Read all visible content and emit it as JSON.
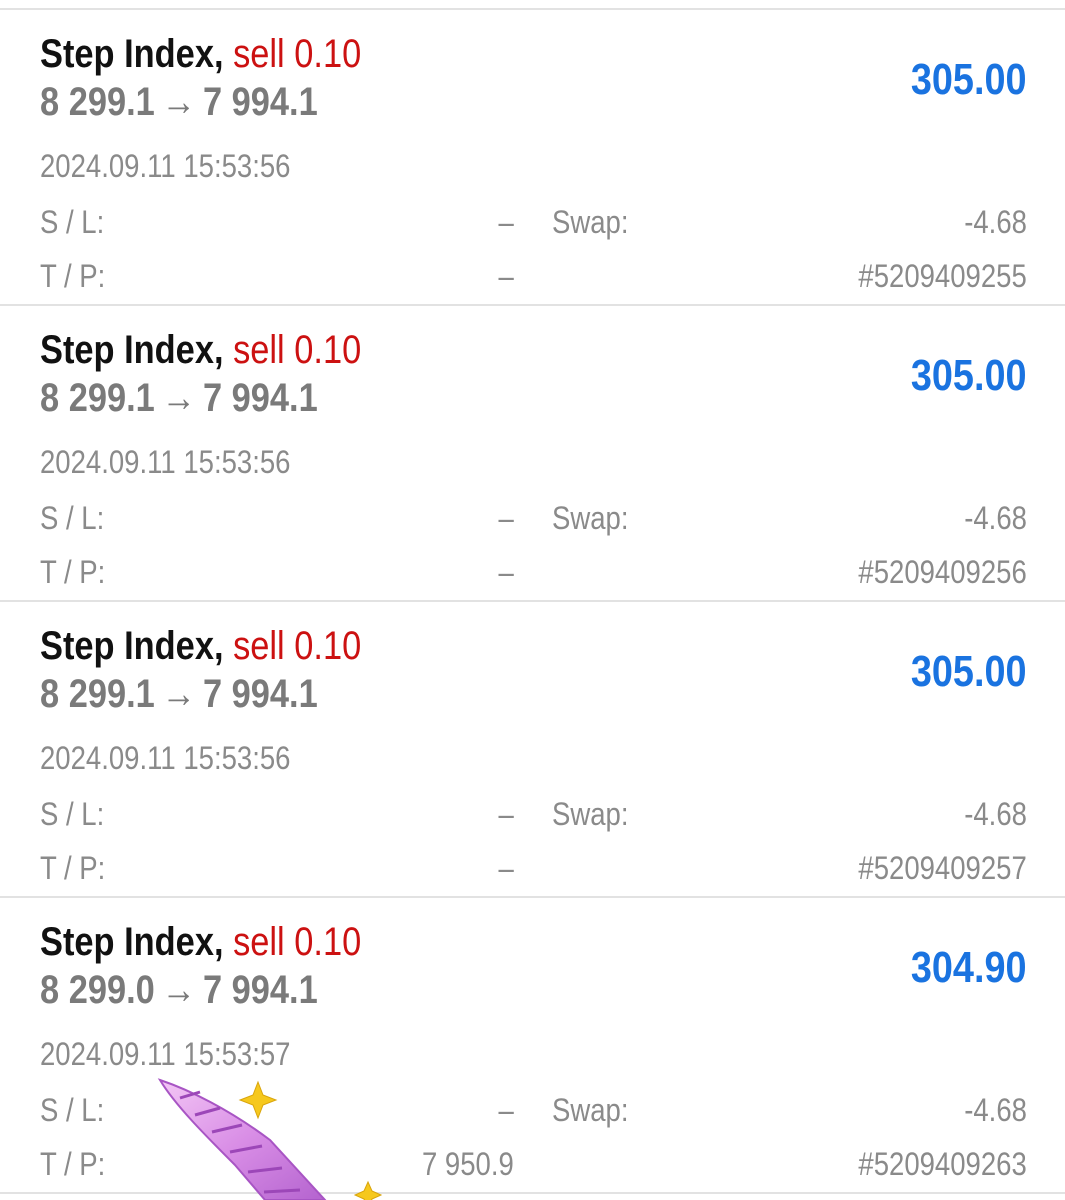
{
  "labels": {
    "sl": "S / L:",
    "tp": "T / P:",
    "swap": "Swap:"
  },
  "trades": [
    {
      "symbol": "Step Index,",
      "action": "sell 0.10",
      "open_price": "8 299.1",
      "arrow": "→",
      "close_price": "7 994.1",
      "profit": "305.00",
      "time": "2024.09.11 15:53:56",
      "sl": "–",
      "tp": "–",
      "swap": "-4.68",
      "ticket": "#5209409255"
    },
    {
      "symbol": "Step Index,",
      "action": "sell 0.10",
      "open_price": "8 299.1",
      "arrow": "→",
      "close_price": "7 994.1",
      "profit": "305.00",
      "time": "2024.09.11 15:53:56",
      "sl": "–",
      "tp": "–",
      "swap": "-4.68",
      "ticket": "#5209409256"
    },
    {
      "symbol": "Step Index,",
      "action": "sell 0.10",
      "open_price": "8 299.1",
      "arrow": "→",
      "close_price": "7 994.1",
      "profit": "305.00",
      "time": "2024.09.11 15:53:56",
      "sl": "–",
      "tp": "–",
      "swap": "-4.68",
      "ticket": "#5209409257"
    },
    {
      "symbol": "Step Index,",
      "action": "sell 0.10",
      "open_price": "8 299.0",
      "arrow": "→",
      "close_price": "7 994.1",
      "profit": "304.90",
      "time": "2024.09.11 15:53:57",
      "sl": "–",
      "tp": "7 950.9",
      "swap": "-4.68",
      "ticket": "#5209409263"
    }
  ],
  "colors": {
    "symbol": "#111111",
    "action_sell": "#cc1111",
    "profit": "#1a73e0",
    "muted": "#8a8a8a",
    "divider": "#e2e2e2"
  },
  "decorations": {
    "sticker": "unicorn-horn-sticker-icon",
    "sparkle": "sparkle-icon"
  }
}
